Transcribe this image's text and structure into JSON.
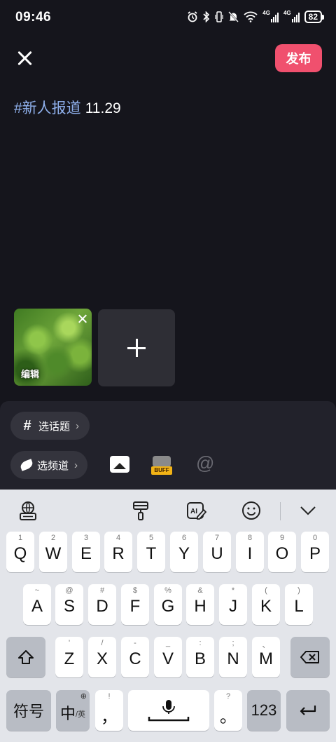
{
  "status_bar": {
    "time": "09:46",
    "battery": "82",
    "icons": [
      "alarm-icon",
      "bluetooth-icon",
      "vibrate-icon",
      "mute-icon",
      "wifi-icon",
      "signal-4g-icon",
      "signal-4g-icon-2",
      "battery-icon"
    ]
  },
  "header": {
    "publish_label": "发布"
  },
  "post": {
    "hashtag": "#新人报道",
    "date": "11.29"
  },
  "media": {
    "edit_label": "编辑"
  },
  "tools": {
    "topic_label": "选话题",
    "channel_label": "选频道",
    "buff_label": "BUFF",
    "at_symbol": "@"
  },
  "keyboard": {
    "row1": [
      {
        "hint": "1",
        "key": "Q"
      },
      {
        "hint": "2",
        "key": "W"
      },
      {
        "hint": "3",
        "key": "E"
      },
      {
        "hint": "4",
        "key": "R"
      },
      {
        "hint": "5",
        "key": "T"
      },
      {
        "hint": "6",
        "key": "Y"
      },
      {
        "hint": "7",
        "key": "U"
      },
      {
        "hint": "8",
        "key": "I"
      },
      {
        "hint": "9",
        "key": "O"
      },
      {
        "hint": "0",
        "key": "P"
      }
    ],
    "row2": [
      {
        "hint": "~",
        "key": "A"
      },
      {
        "hint": "@",
        "key": "S"
      },
      {
        "hint": "#",
        "key": "D"
      },
      {
        "hint": "$",
        "key": "F"
      },
      {
        "hint": "%",
        "key": "G"
      },
      {
        "hint": "&",
        "key": "H"
      },
      {
        "hint": "*",
        "key": "J"
      },
      {
        "hint": "(",
        "key": "K"
      },
      {
        "hint": ")",
        "key": "L"
      }
    ],
    "row3": [
      {
        "hint": "'",
        "key": "Z"
      },
      {
        "hint": "/",
        "key": "X"
      },
      {
        "hint": "-",
        "key": "C"
      },
      {
        "hint": "_",
        "key": "V"
      },
      {
        "hint": ":",
        "key": "B"
      },
      {
        "hint": ";",
        "key": "N"
      },
      {
        "hint": "、",
        "key": "M"
      }
    ],
    "symbols_label": "符号",
    "lang_main": "中",
    "lang_sub": "/英",
    "comma_hint": "!",
    "comma": "，",
    "period_hint": "?",
    "period": "。",
    "numbers_label": "123"
  }
}
